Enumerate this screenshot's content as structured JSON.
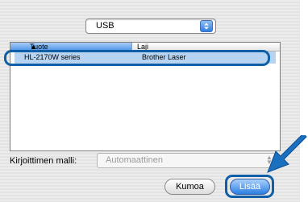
{
  "popup": {
    "value": "USB"
  },
  "list": {
    "columns": [
      "Tuote",
      "Laji"
    ],
    "rows": [
      {
        "product": "HL-2170W series",
        "kind": "Brother Laser"
      }
    ]
  },
  "model": {
    "label": "Kirjoittimen malli:",
    "value": "Automaattinen"
  },
  "buttons": {
    "cancel": "Kumoa",
    "add": "Lisää"
  },
  "colors": {
    "highlight_outline": "#0f5ea8",
    "arrow": "#1a6fbf",
    "selection": "#b6d3f2"
  }
}
